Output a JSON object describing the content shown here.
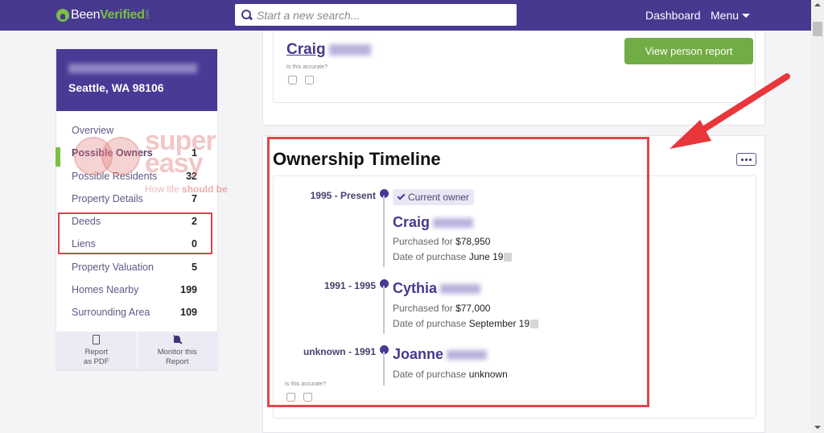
{
  "navbar": {
    "logo_part1": "Been",
    "logo_part2": "Verified",
    "logo_suffix": ".com",
    "search_placeholder": "Start a new search...",
    "dashboard_label": "Dashboard",
    "menu_label": "Menu"
  },
  "sidebar": {
    "address_city": "Seattle, WA 98106",
    "items": [
      {
        "label": "Overview",
        "count": ""
      },
      {
        "label": "Possible Owners",
        "count": "1"
      },
      {
        "label": "Possible Residents",
        "count": "32"
      },
      {
        "label": "Property Details",
        "count": "7"
      },
      {
        "label": "Deeds",
        "count": "2"
      },
      {
        "label": "Liens",
        "count": "0"
      },
      {
        "label": "Property Valuation",
        "count": "5"
      },
      {
        "label": "Homes Nearby",
        "count": "199"
      },
      {
        "label": "Surrounding Area",
        "count": "109"
      }
    ],
    "footer": {
      "pdf_line1": "Report",
      "pdf_line2": "as PDF",
      "monitor_line1": "Monitor this",
      "monitor_line2": "Report"
    }
  },
  "watermark": {
    "line1": "super",
    "line2": "easy",
    "tag_plain": "How life ",
    "tag_bold": "should be"
  },
  "top_card": {
    "person_first": "Craig",
    "accurate_prompt": "Is this accurate?",
    "view_button": "View person report"
  },
  "timeline": {
    "title": "Ownership Timeline",
    "accurate_prompt": "Is this accurate?",
    "entries": [
      {
        "range": "1995 - Present",
        "badge": "Current owner",
        "name": "Craig",
        "purchased_label": "Purchased for",
        "purchased_value": "$78,950",
        "date_label": "Date of purchase",
        "date_value": "June 19"
      },
      {
        "range": "1991 - 1995",
        "name": "Cythia",
        "purchased_label": "Purchased for",
        "purchased_value": "$77,000",
        "date_label": "Date of purchase",
        "date_value": "September 19"
      },
      {
        "range": "unknown - 1991",
        "name": "Joanne",
        "date_label": "Date of purchase",
        "date_value": "unknown"
      }
    ]
  },
  "colors": {
    "brand_purple": "#46398f",
    "brand_green": "#7cbf45",
    "button_green": "#72ac44",
    "annotation_red": "#e04848"
  }
}
